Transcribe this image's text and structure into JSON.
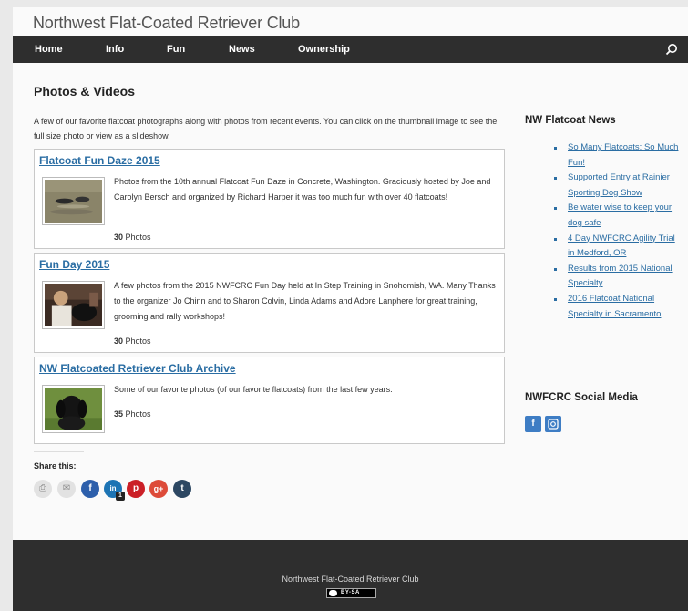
{
  "site": {
    "title": "Northwest Flat-Coated Retriever Club"
  },
  "nav": {
    "items": [
      "Home",
      "Info",
      "Fun",
      "News",
      "Ownership"
    ]
  },
  "main": {
    "heading": "Photos & Videos",
    "intro": "A few of our favorite flatcoat photographs along with photos from recent events. You can click on the thumbnail image to see the full size photo or view as a slideshow.",
    "albums": [
      {
        "title": "Flatcoat Fun Daze 2015",
        "description": "Photos from the 10th annual Flatcoat Fun Daze in Concrete, Washington. Graciously hosted by Joe and Carolyn Bersch and organized by Richard Harper it was too much fun with over 40 flatcoats!",
        "count": "30",
        "count_label": "Photos"
      },
      {
        "title": "Fun Day 2015",
        "description": "A few photos from the 2015 NWFCRC Fun Day held at In Step Training in Snohomish, WA. Many Thanks to the organizer Jo Chinn and to Sharon Colvin, Linda Adams and Adore Lanphere for great training, grooming and rally workshops!",
        "count": "30",
        "count_label": "Photos"
      },
      {
        "title": "NW Flatcoated Retriever Club Archive",
        "description": "Some of our favorite photos (of our favorite flatcoats) from the last few years.",
        "count": "35",
        "count_label": "Photos"
      }
    ],
    "share": {
      "title": "Share this:",
      "buttons": [
        {
          "icon": "print-icon",
          "glyph": "⎙",
          "color": "#e2e2e2"
        },
        {
          "icon": "email-icon",
          "glyph": "✉",
          "color": "#e2e2e2"
        },
        {
          "icon": "facebook-icon",
          "glyph": "f",
          "color": "#2d5fab"
        },
        {
          "icon": "linkedin-icon",
          "glyph": "in",
          "color": "#1d74b4"
        },
        {
          "icon": "pinterest-icon",
          "glyph": "p",
          "color": "#cb2027"
        },
        {
          "icon": "google-plus-icon",
          "glyph": "g+",
          "color": "#dd4b39"
        },
        {
          "icon": "tumblr-icon",
          "glyph": "t",
          "color": "#2c4762"
        }
      ],
      "linkedin_count": "1"
    }
  },
  "sidebar": {
    "news_heading": "NW Flatcoat News",
    "news": [
      "So Many Flatcoats; So Much Fun!",
      "Supported Entry at Rainier Sporting Dog Show",
      "Be water wise to keep your dog safe",
      "4 Day NWFCRC Agility Trial in Medford, OR",
      "Results from 2015 National Specialty",
      "2016 Flatcoat National Specialty in Sacramento"
    ],
    "social_heading": "NWFCRC Social Media",
    "social": [
      {
        "icon": "facebook-icon",
        "glyph": "f"
      },
      {
        "icon": "instagram-icon",
        "glyph": "◙"
      }
    ]
  },
  "footer": {
    "text": "Northwest Flat-Coated Retriever Club",
    "license": "BY-SA"
  },
  "colors": {
    "nav_bg": "#2e2e2e",
    "link": "#2a6da3",
    "social": "#3e7dc4"
  }
}
